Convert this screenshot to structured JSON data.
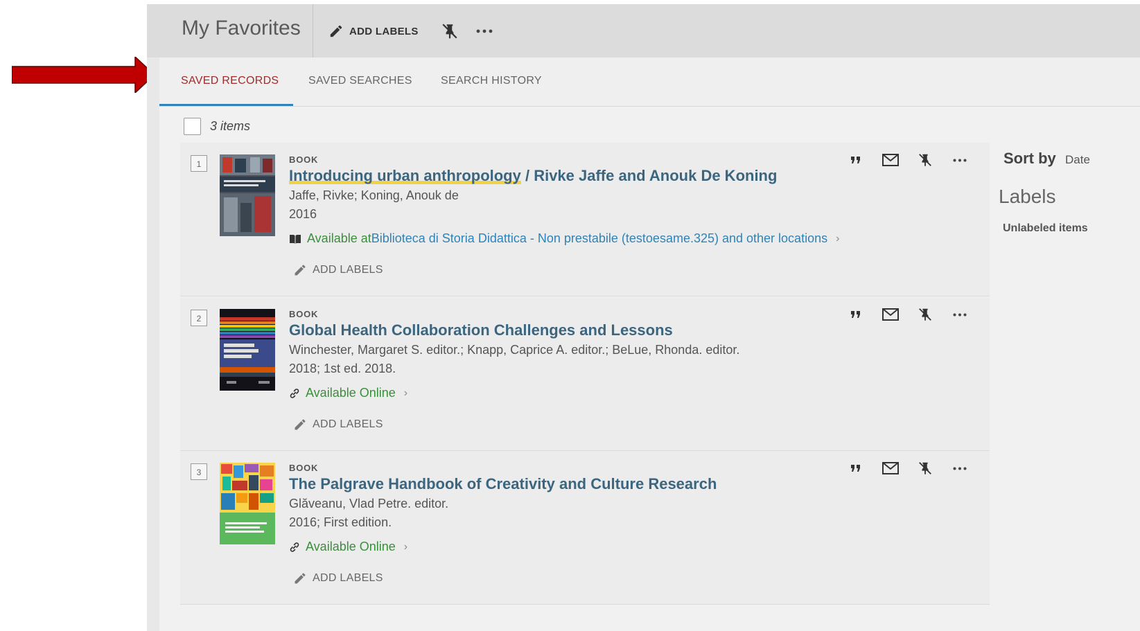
{
  "header": {
    "title": "My Favorites",
    "add_labels": "ADD LABELS"
  },
  "tabs": [
    {
      "label": "SAVED RECORDS",
      "active": true
    },
    {
      "label": "SAVED SEARCHES",
      "active": false
    },
    {
      "label": "SEARCH HISTORY",
      "active": false
    }
  ],
  "list": {
    "count_label": "3 items"
  },
  "records": [
    {
      "number": "1",
      "type": "BOOK",
      "title_main": "Introducing urban anthropology",
      "title_rest": " / Rivke Jaffe and Anouk De Koning",
      "authors": "Jaffe, Rivke; Koning, Anouk de",
      "date": "2016",
      "availability_prefix": "Available at ",
      "availability_location": "Biblioteca di Storia  Didattica - Non prestabile (testoesame.325) and other locations",
      "availability_icon": "book-icon",
      "add_labels": "ADD LABELS"
    },
    {
      "number": "2",
      "type": "BOOK",
      "title_main": "Global Health Collaboration Challenges and Lessons",
      "title_rest": "",
      "authors": "Winchester, Margaret S. editor.; Knapp, Caprice A. editor.; BeLue, Rhonda. editor.",
      "date": "2018; 1st ed. 2018.",
      "availability_prefix": "Available Online",
      "availability_location": "",
      "availability_icon": "link-icon",
      "add_labels": "ADD LABELS"
    },
    {
      "number": "3",
      "type": "BOOK",
      "title_main": "The Palgrave Handbook of Creativity and Culture Research",
      "title_rest": "",
      "authors": "Glăveanu, Vlad Petre. editor.",
      "date": "2016; First edition.",
      "availability_prefix": "Available Online",
      "availability_location": "",
      "availability_icon": "link-icon",
      "add_labels": "ADD LABELS"
    }
  ],
  "sidebar": {
    "sort_by": "Sort by",
    "sort_value": "Date",
    "labels_heading": "Labels",
    "unlabeled": "Unlabeled items"
  },
  "colors": {
    "active_tab": "#a32a2a",
    "tab_underline": "#2f83b7",
    "title_link": "#3c6580",
    "available": "#3a8f3a",
    "arrow": "#c00000"
  }
}
